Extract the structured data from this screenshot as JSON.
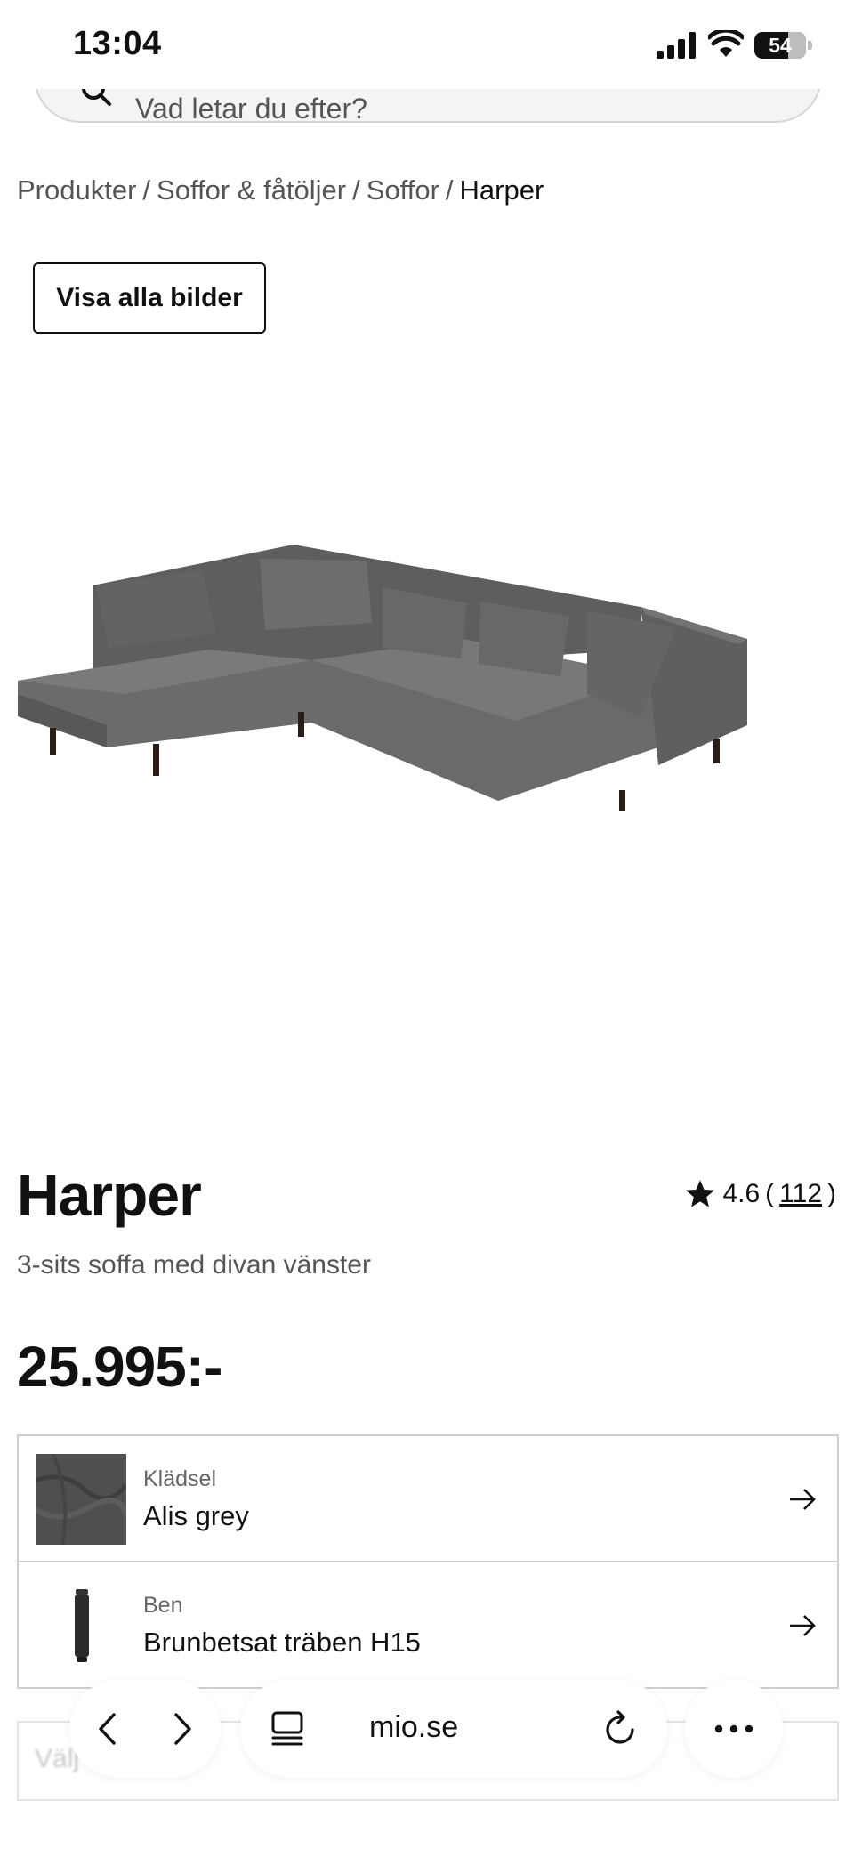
{
  "status_bar": {
    "time": "13:04",
    "battery": "54"
  },
  "search": {
    "placeholder": "Vad letar du efter?"
  },
  "breadcrumb": {
    "items": [
      "Produkter",
      "Soffor & fåtöljer",
      "Soffor"
    ],
    "current": "Harper",
    "separator": "/"
  },
  "gallery": {
    "show_all_label": "Visa alla bilder"
  },
  "product": {
    "name": "Harper",
    "subtitle": "3-sits soffa med divan vänster",
    "rating": "4.6",
    "review_count": "112",
    "price": "25.995:-"
  },
  "options": [
    {
      "label": "Klädsel",
      "value": "Alis grey"
    },
    {
      "label": "Ben",
      "value": "Brunbetsat träben H15"
    }
  ],
  "partial_row": {
    "text": "Välj ... att se"
  },
  "browser": {
    "url": "mio.se"
  },
  "colors": {
    "upholstery": "#666666",
    "legs": "#2a1d17"
  }
}
